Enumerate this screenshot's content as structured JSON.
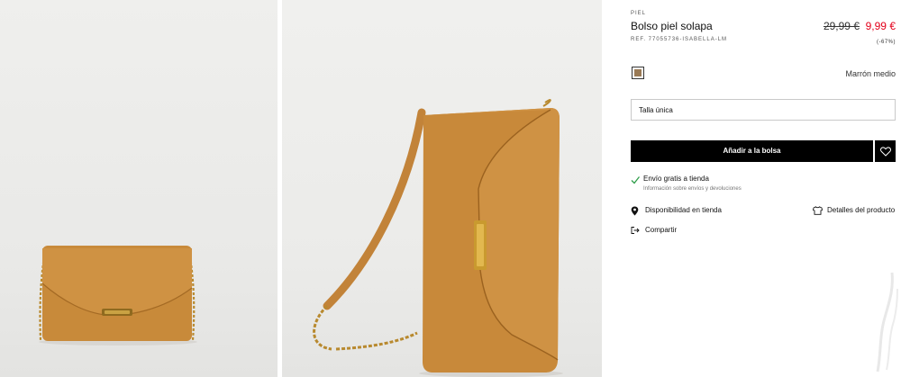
{
  "gallery": {
    "images": [
      {
        "alt": "Bolso piel solapa - frontal"
      },
      {
        "alt": "Bolso piel solapa - lateral"
      }
    ]
  },
  "product": {
    "category": "PIEL",
    "title": "Bolso piel solapa",
    "ref": "REF. 77055736-ISABELLA-LM",
    "old_price": "29,99 €",
    "price": "9,99 €",
    "discount": "(-67%)",
    "color_name": "Marrón medio",
    "swatch_color": "#9a7a55",
    "size_label": "Talla única",
    "add_to_bag_label": "Añadir a la bolsa"
  },
  "shipping": {
    "title": "Envío gratis a tienda",
    "subtitle": "Información sobre envíos y devoluciones"
  },
  "links": {
    "store_availability": "Disponibilidad en tienda",
    "product_details": "Detalles del producto",
    "share": "Compartir"
  },
  "colors": {
    "price_sale": "#e3001b",
    "button_bg": "#000000",
    "leather": "#c98b3c"
  }
}
